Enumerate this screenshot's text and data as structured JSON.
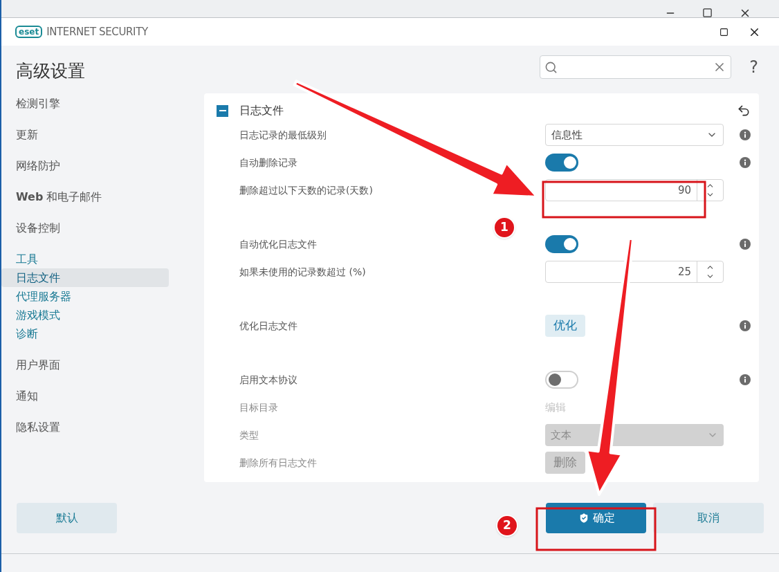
{
  "app": {
    "logo": "eset",
    "title": "INTERNET SECURITY"
  },
  "page_title": "高级设置",
  "help": "?",
  "sidebar": {
    "items": [
      {
        "label": "检测引擎",
        "selected": false
      },
      {
        "label": "更新",
        "selected": false
      },
      {
        "label": "网络防护",
        "selected": false
      },
      {
        "label": "**Web** 和电子邮件",
        "selected": false
      },
      {
        "label": "设备控制",
        "selected": false
      },
      {
        "label": "工具",
        "selected": false,
        "expanded": true,
        "children": [
          {
            "label": "日志文件",
            "selected": true
          },
          {
            "label": "代理服务器",
            "selected": false
          },
          {
            "label": "游戏模式",
            "selected": false
          },
          {
            "label": "诊断",
            "selected": false
          }
        ]
      },
      {
        "label": "用户界面",
        "selected": false
      },
      {
        "label": "通知",
        "selected": false
      },
      {
        "label": "隐私设置",
        "selected": false
      }
    ]
  },
  "panel": {
    "title": "日志文件",
    "expanded": true,
    "sections": [
      [
        {
          "kind": "select",
          "label": "日志记录的最低级别",
          "value": "信息性",
          "info": true
        },
        {
          "kind": "toggle",
          "label": "自动删除记录",
          "on": true,
          "info": true
        },
        {
          "kind": "number",
          "label": "删除超过以下天数的记录(天数)",
          "value": "90"
        }
      ],
      [
        {
          "kind": "toggle",
          "label": "自动优化日志文件",
          "on": true,
          "info": true
        },
        {
          "kind": "number",
          "label": "如果未使用的记录数超过 (%)",
          "value": "25"
        }
      ],
      [
        {
          "kind": "button",
          "label": "优化日志文件",
          "value": "优化",
          "info": true
        }
      ],
      [
        {
          "kind": "toggle",
          "label": "启用文本协议",
          "on": false,
          "info": true
        },
        {
          "kind": "link",
          "label": "目标目录",
          "value": "编辑",
          "disabled": true
        },
        {
          "kind": "select",
          "label": "类型",
          "value": "文本",
          "disabled": true
        },
        {
          "kind": "button",
          "label": "删除所有日志文件",
          "value": "删除",
          "disabled": true
        }
      ]
    ]
  },
  "footer": {
    "default_button": "默认",
    "ok_button": "确定",
    "cancel_button": "取消"
  },
  "annotations": [
    {
      "label": "1"
    },
    {
      "label": "2"
    }
  ]
}
